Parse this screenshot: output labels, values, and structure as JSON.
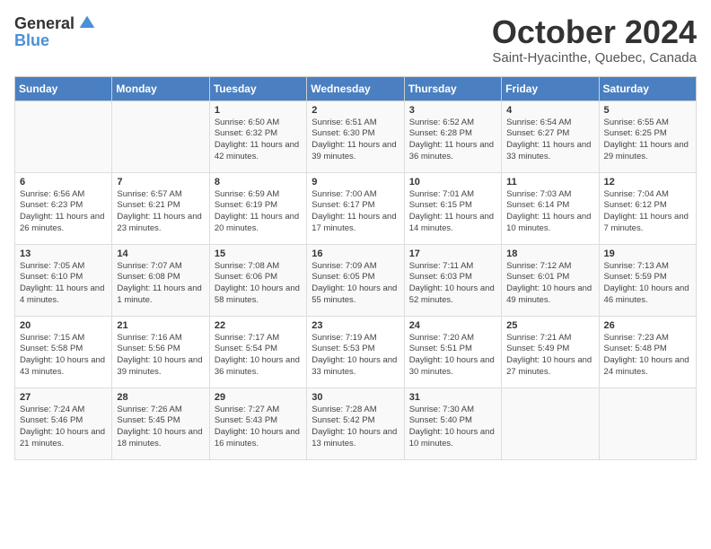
{
  "header": {
    "logo_general": "General",
    "logo_blue": "Blue",
    "month_title": "October 2024",
    "location": "Saint-Hyacinthe, Quebec, Canada"
  },
  "days_of_week": [
    "Sunday",
    "Monday",
    "Tuesday",
    "Wednesday",
    "Thursday",
    "Friday",
    "Saturday"
  ],
  "weeks": [
    [
      {
        "day": "",
        "sunrise": "",
        "sunset": "",
        "daylight": ""
      },
      {
        "day": "",
        "sunrise": "",
        "sunset": "",
        "daylight": ""
      },
      {
        "day": "1",
        "sunrise": "Sunrise: 6:50 AM",
        "sunset": "Sunset: 6:32 PM",
        "daylight": "Daylight: 11 hours and 42 minutes."
      },
      {
        "day": "2",
        "sunrise": "Sunrise: 6:51 AM",
        "sunset": "Sunset: 6:30 PM",
        "daylight": "Daylight: 11 hours and 39 minutes."
      },
      {
        "day": "3",
        "sunrise": "Sunrise: 6:52 AM",
        "sunset": "Sunset: 6:28 PM",
        "daylight": "Daylight: 11 hours and 36 minutes."
      },
      {
        "day": "4",
        "sunrise": "Sunrise: 6:54 AM",
        "sunset": "Sunset: 6:27 PM",
        "daylight": "Daylight: 11 hours and 33 minutes."
      },
      {
        "day": "5",
        "sunrise": "Sunrise: 6:55 AM",
        "sunset": "Sunset: 6:25 PM",
        "daylight": "Daylight: 11 hours and 29 minutes."
      }
    ],
    [
      {
        "day": "6",
        "sunrise": "Sunrise: 6:56 AM",
        "sunset": "Sunset: 6:23 PM",
        "daylight": "Daylight: 11 hours and 26 minutes."
      },
      {
        "day": "7",
        "sunrise": "Sunrise: 6:57 AM",
        "sunset": "Sunset: 6:21 PM",
        "daylight": "Daylight: 11 hours and 23 minutes."
      },
      {
        "day": "8",
        "sunrise": "Sunrise: 6:59 AM",
        "sunset": "Sunset: 6:19 PM",
        "daylight": "Daylight: 11 hours and 20 minutes."
      },
      {
        "day": "9",
        "sunrise": "Sunrise: 7:00 AM",
        "sunset": "Sunset: 6:17 PM",
        "daylight": "Daylight: 11 hours and 17 minutes."
      },
      {
        "day": "10",
        "sunrise": "Sunrise: 7:01 AM",
        "sunset": "Sunset: 6:15 PM",
        "daylight": "Daylight: 11 hours and 14 minutes."
      },
      {
        "day": "11",
        "sunrise": "Sunrise: 7:03 AM",
        "sunset": "Sunset: 6:14 PM",
        "daylight": "Daylight: 11 hours and 10 minutes."
      },
      {
        "day": "12",
        "sunrise": "Sunrise: 7:04 AM",
        "sunset": "Sunset: 6:12 PM",
        "daylight": "Daylight: 11 hours and 7 minutes."
      }
    ],
    [
      {
        "day": "13",
        "sunrise": "Sunrise: 7:05 AM",
        "sunset": "Sunset: 6:10 PM",
        "daylight": "Daylight: 11 hours and 4 minutes."
      },
      {
        "day": "14",
        "sunrise": "Sunrise: 7:07 AM",
        "sunset": "Sunset: 6:08 PM",
        "daylight": "Daylight: 11 hours and 1 minute."
      },
      {
        "day": "15",
        "sunrise": "Sunrise: 7:08 AM",
        "sunset": "Sunset: 6:06 PM",
        "daylight": "Daylight: 10 hours and 58 minutes."
      },
      {
        "day": "16",
        "sunrise": "Sunrise: 7:09 AM",
        "sunset": "Sunset: 6:05 PM",
        "daylight": "Daylight: 10 hours and 55 minutes."
      },
      {
        "day": "17",
        "sunrise": "Sunrise: 7:11 AM",
        "sunset": "Sunset: 6:03 PM",
        "daylight": "Daylight: 10 hours and 52 minutes."
      },
      {
        "day": "18",
        "sunrise": "Sunrise: 7:12 AM",
        "sunset": "Sunset: 6:01 PM",
        "daylight": "Daylight: 10 hours and 49 minutes."
      },
      {
        "day": "19",
        "sunrise": "Sunrise: 7:13 AM",
        "sunset": "Sunset: 5:59 PM",
        "daylight": "Daylight: 10 hours and 46 minutes."
      }
    ],
    [
      {
        "day": "20",
        "sunrise": "Sunrise: 7:15 AM",
        "sunset": "Sunset: 5:58 PM",
        "daylight": "Daylight: 10 hours and 43 minutes."
      },
      {
        "day": "21",
        "sunrise": "Sunrise: 7:16 AM",
        "sunset": "Sunset: 5:56 PM",
        "daylight": "Daylight: 10 hours and 39 minutes."
      },
      {
        "day": "22",
        "sunrise": "Sunrise: 7:17 AM",
        "sunset": "Sunset: 5:54 PM",
        "daylight": "Daylight: 10 hours and 36 minutes."
      },
      {
        "day": "23",
        "sunrise": "Sunrise: 7:19 AM",
        "sunset": "Sunset: 5:53 PM",
        "daylight": "Daylight: 10 hours and 33 minutes."
      },
      {
        "day": "24",
        "sunrise": "Sunrise: 7:20 AM",
        "sunset": "Sunset: 5:51 PM",
        "daylight": "Daylight: 10 hours and 30 minutes."
      },
      {
        "day": "25",
        "sunrise": "Sunrise: 7:21 AM",
        "sunset": "Sunset: 5:49 PM",
        "daylight": "Daylight: 10 hours and 27 minutes."
      },
      {
        "day": "26",
        "sunrise": "Sunrise: 7:23 AM",
        "sunset": "Sunset: 5:48 PM",
        "daylight": "Daylight: 10 hours and 24 minutes."
      }
    ],
    [
      {
        "day": "27",
        "sunrise": "Sunrise: 7:24 AM",
        "sunset": "Sunset: 5:46 PM",
        "daylight": "Daylight: 10 hours and 21 minutes."
      },
      {
        "day": "28",
        "sunrise": "Sunrise: 7:26 AM",
        "sunset": "Sunset: 5:45 PM",
        "daylight": "Daylight: 10 hours and 18 minutes."
      },
      {
        "day": "29",
        "sunrise": "Sunrise: 7:27 AM",
        "sunset": "Sunset: 5:43 PM",
        "daylight": "Daylight: 10 hours and 16 minutes."
      },
      {
        "day": "30",
        "sunrise": "Sunrise: 7:28 AM",
        "sunset": "Sunset: 5:42 PM",
        "daylight": "Daylight: 10 hours and 13 minutes."
      },
      {
        "day": "31",
        "sunrise": "Sunrise: 7:30 AM",
        "sunset": "Sunset: 5:40 PM",
        "daylight": "Daylight: 10 hours and 10 minutes."
      },
      {
        "day": "",
        "sunrise": "",
        "sunset": "",
        "daylight": ""
      },
      {
        "day": "",
        "sunrise": "",
        "sunset": "",
        "daylight": ""
      }
    ]
  ]
}
